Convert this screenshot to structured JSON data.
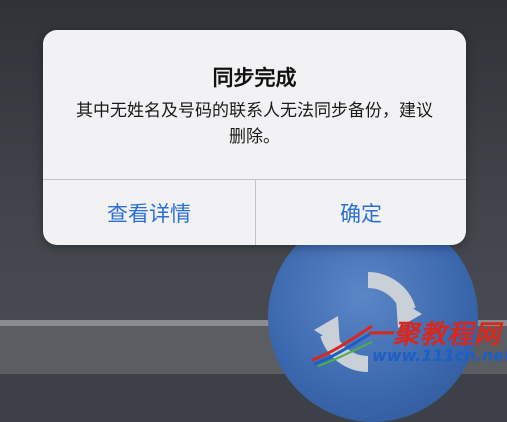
{
  "dialog": {
    "title": "同步完成",
    "message": "其中无姓名及号码的联系人无法同步备份，建议删除。",
    "buttons": {
      "left": "查看详情",
      "right": "确定"
    }
  },
  "watermark": {
    "brand": "一聚教程网",
    "url": "www.111cn.net"
  },
  "colors": {
    "accent": "#2a6fd6",
    "sync_icon": "#3a66ad",
    "watermark_red": "#d8281e",
    "watermark_blue": "#1f5fc4"
  },
  "icons": [
    "sync-arrows-icon",
    "watermark-swoosh-icon"
  ]
}
